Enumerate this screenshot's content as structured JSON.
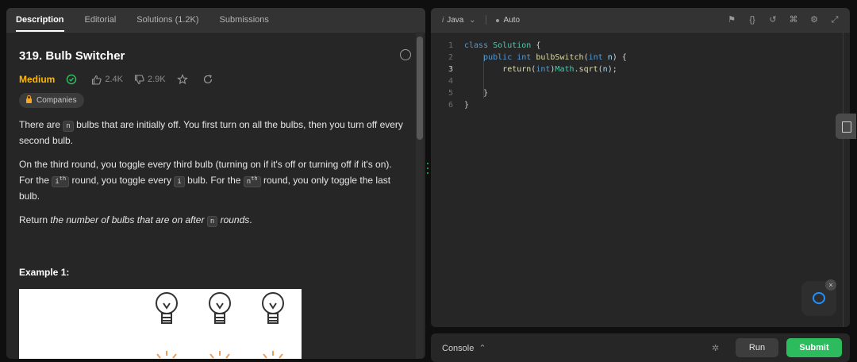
{
  "tabs": [
    "Description",
    "Editorial",
    "Solutions (1.2K)",
    "Submissions"
  ],
  "problem": {
    "title": "319. Bulb Switcher",
    "difficulty": "Medium",
    "likes": "2.4K",
    "dislikes": "2.9K",
    "companies": "Companies",
    "p1_a": "There are ",
    "p1_code": "n",
    "p1_b": " bulbs that are initially off. You first turn on all the bulbs, then you turn off every second bulb.",
    "p2_a": "On the third round, you toggle every third bulb (turning on if it's off or turning off if it's on). For the ",
    "p2_code1": "i",
    "p2_sup1": "th",
    "p2_b": " round, you toggle every ",
    "p2_code2": "i",
    "p2_c": " bulb. For the ",
    "p2_code3": "n",
    "p2_sup3": "th",
    "p2_d": " round, you only toggle the last bulb.",
    "p3_a": "Return ",
    "p3_em": "the number of bulbs that are on after ",
    "p3_code": "n",
    "p3_em2": " rounds",
    "p3_end": ".",
    "example_title": "Example 1:"
  },
  "editor": {
    "language": "Java",
    "mode": "Auto",
    "lines": [
      {
        "num": "1",
        "text": "class Solution {"
      },
      {
        "num": "2",
        "text": "    public int bulbSwitch(int n) {"
      },
      {
        "num": "3",
        "text": "        return(int)Math.sqrt(n);"
      },
      {
        "num": "4",
        "text": ""
      },
      {
        "num": "5",
        "text": "    }"
      },
      {
        "num": "6",
        "text": "}"
      }
    ]
  },
  "console": {
    "label": "Console",
    "run": "Run",
    "submit": "Submit"
  }
}
